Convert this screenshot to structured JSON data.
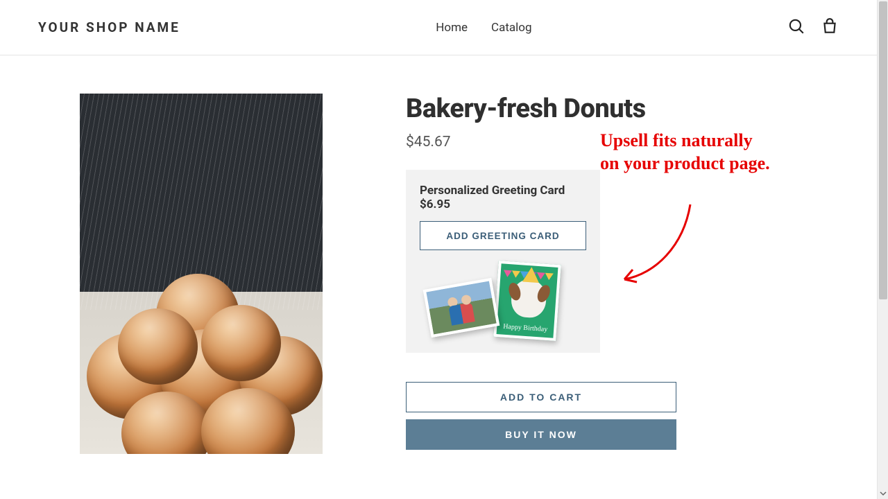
{
  "header": {
    "logo": "YOUR SHOP NAME",
    "nav": {
      "home": "Home",
      "catalog": "Catalog"
    }
  },
  "product": {
    "title": "Bakery-fresh Donuts",
    "price": "$45.67"
  },
  "upsell": {
    "title": "Personalized Greeting Card",
    "price": "$6.95",
    "button": "ADD GREETING CARD",
    "card_text": "Happy Birthday"
  },
  "actions": {
    "add_to_cart": "ADD TO CART",
    "buy_now": "BUY IT NOW"
  },
  "annotation": {
    "line1": "Upsell fits naturally",
    "line2": "on your product page."
  }
}
